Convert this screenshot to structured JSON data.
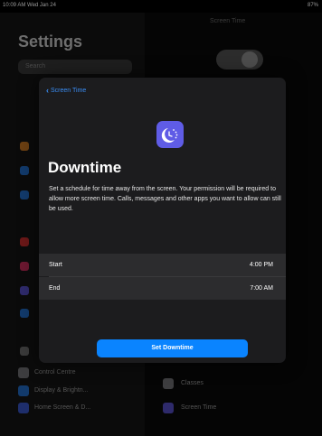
{
  "status_bar": {
    "time_date": "10:09 AM  Wed Jan 24",
    "battery": "87%"
  },
  "background": {
    "title": "Settings",
    "search_placeholder": "Search",
    "nav_title": "Screen Time",
    "sidebar_items": [
      {
        "label": "Control Centre",
        "color": "#8e8e93"
      },
      {
        "label": "Display & Brightn...",
        "color": "#0a84ff"
      },
      {
        "label": "Home Screen & D...",
        "color": "#3a56d4"
      }
    ],
    "detail_items": [
      {
        "label": "Classes",
        "color": "#8e8e93"
      },
      {
        "label": "Screen Time",
        "color": "#5f5ce6"
      }
    ]
  },
  "modal": {
    "back_label": "Screen Time",
    "icon": "downtime-icon",
    "title": "Downtime",
    "description": "Set a schedule for time away from the screen. Your permission will be required to allow more screen time. Calls, messages and other apps you want to allow can still be used.",
    "start_label": "Start",
    "start_value": "4:00 PM",
    "end_label": "End",
    "end_value": "7:00 AM",
    "button_label": "Set Downtime"
  },
  "colors": {
    "accent": "#0a84ff",
    "icon_bg": "#5f5ce6",
    "modal_bg": "#1c1c1e"
  }
}
